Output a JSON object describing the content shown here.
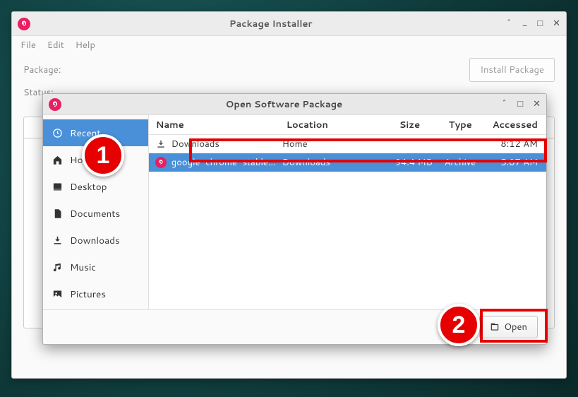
{
  "main_window": {
    "title": "Package Installer",
    "menu": {
      "file": "File",
      "edit": "Edit",
      "help": "Help"
    },
    "package_label": "Package:",
    "status_label": "Status:",
    "install_button": "Install Package"
  },
  "dialog": {
    "title": "Open Software Package",
    "sidebar": {
      "items": [
        {
          "label": "Recent",
          "icon": "clock-icon",
          "selected": true
        },
        {
          "label": "Home",
          "icon": "home-icon"
        },
        {
          "label": "Desktop",
          "icon": "desktop-icon"
        },
        {
          "label": "Documents",
          "icon": "document-icon"
        },
        {
          "label": "Downloads",
          "icon": "download-icon"
        },
        {
          "label": "Music",
          "icon": "music-icon"
        },
        {
          "label": "Pictures",
          "icon": "pictures-icon"
        }
      ]
    },
    "columns": {
      "name": "Name",
      "location": "Location",
      "size": "Size",
      "type": "Type",
      "accessed": "Accessed"
    },
    "files": [
      {
        "name": "Downloads",
        "location": "Home",
        "size": "",
        "type": "",
        "accessed": "8:12 AM",
        "icon": "download-icon",
        "selected": false
      },
      {
        "name": "google-chrome-stable...",
        "location": "Downloads",
        "size": "94.4 MB",
        "type": "Archive",
        "accessed": "5:07 AM",
        "icon": "deb-icon",
        "selected": true
      }
    ],
    "open_button": "Open"
  },
  "annotations": {
    "badge1": "1",
    "badge2": "2"
  }
}
